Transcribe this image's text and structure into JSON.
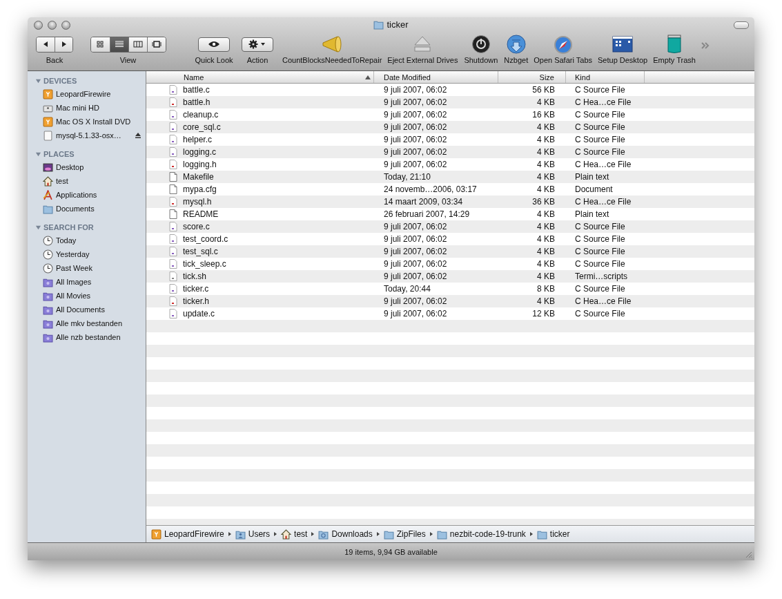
{
  "window": {
    "title": "ticker"
  },
  "toolbar": [
    {
      "kind": "nav",
      "label": "Back"
    },
    {
      "kind": "view",
      "label": "View",
      "segments": [
        {
          "selected": false
        },
        {
          "selected": true
        },
        {
          "selected": false
        },
        {
          "selected": false
        }
      ]
    },
    {
      "kind": "quicklook",
      "label": "Quick Look"
    },
    {
      "kind": "action",
      "label": "Action"
    },
    {
      "kind": "megaphone",
      "label": "CountBlocksNeededToRepair"
    },
    {
      "kind": "eject",
      "label": "Eject External Drives"
    },
    {
      "kind": "power",
      "label": "Shutdown"
    },
    {
      "kind": "download",
      "label": "Nzbget"
    },
    {
      "kind": "compass",
      "label": "Open Safari Tabs"
    },
    {
      "kind": "desktop",
      "label": "Setup Desktop"
    },
    {
      "kind": "trash",
      "label": "Empty Trash"
    }
  ],
  "sidebar": [
    {
      "title": "DEVICES",
      "expanded": true,
      "items": [
        {
          "label": "LeopardFirewire",
          "kind": "firewire",
          "ejectable": false
        },
        {
          "label": "Mac mini HD",
          "kind": "disk",
          "ejectable": false
        },
        {
          "label": "Mac OS X Install DVD",
          "kind": "firewire",
          "ejectable": false
        },
        {
          "label": "mysql-5.1.33-osx…",
          "kind": "image",
          "ejectable": true
        }
      ]
    },
    {
      "title": "PLACES",
      "expanded": true,
      "items": [
        {
          "label": "Desktop",
          "kind": "desktop"
        },
        {
          "label": "test",
          "kind": "home"
        },
        {
          "label": "Applications",
          "kind": "apps"
        },
        {
          "label": "Documents",
          "kind": "folder"
        }
      ]
    },
    {
      "title": "SEARCH FOR",
      "expanded": true,
      "items": [
        {
          "label": "Today",
          "kind": "clock"
        },
        {
          "label": "Yesterday",
          "kind": "clock"
        },
        {
          "label": "Past Week",
          "kind": "clock"
        },
        {
          "label": "All Images",
          "kind": "smart"
        },
        {
          "label": "All Movies",
          "kind": "smart"
        },
        {
          "label": "All Documents",
          "kind": "smart"
        },
        {
          "label": "Alle mkv bestanden",
          "kind": "smart"
        },
        {
          "label": "Alle nzb bestanden",
          "kind": "smart"
        }
      ]
    }
  ],
  "table": {
    "columns": [
      {
        "label": "Name",
        "sorted": true
      },
      {
        "label": "Date Modified",
        "sorted": false
      },
      {
        "label": "Size",
        "sorted": false
      },
      {
        "label": "Kind",
        "sorted": false
      }
    ],
    "rows": [
      {
        "kind": "c",
        "name": "battle.c",
        "date": "9 juli 2007, 06:02",
        "size": "56 KB",
        "type": "C Source File"
      },
      {
        "kind": "h",
        "name": "battle.h",
        "date": "9 juli 2007, 06:02",
        "size": "4 KB",
        "type": "C Hea…ce File"
      },
      {
        "kind": "c",
        "name": "cleanup.c",
        "date": "9 juli 2007, 06:02",
        "size": "16 KB",
        "type": "C Source File"
      },
      {
        "kind": "c",
        "name": "core_sql.c",
        "date": "9 juli 2007, 06:02",
        "size": "4 KB",
        "type": "C Source File"
      },
      {
        "kind": "c",
        "name": "helper.c",
        "date": "9 juli 2007, 06:02",
        "size": "4 KB",
        "type": "C Source File"
      },
      {
        "kind": "c",
        "name": "logging.c",
        "date": "9 juli 2007, 06:02",
        "size": "4 KB",
        "type": "C Source File"
      },
      {
        "kind": "h",
        "name": "logging.h",
        "date": "9 juli 2007, 06:02",
        "size": "4 KB",
        "type": "C Hea…ce File"
      },
      {
        "kind": "plain",
        "name": "Makefile",
        "date": "Today, 21:10",
        "size": "4 KB",
        "type": "Plain text"
      },
      {
        "kind": "plain",
        "name": "mypa.cfg",
        "date": "24 novemb…2006, 03:17",
        "size": "4 KB",
        "type": "Document"
      },
      {
        "kind": "h",
        "name": "mysql.h",
        "date": "14 maart 2009, 03:34",
        "size": "36 KB",
        "type": "C Hea…ce File"
      },
      {
        "kind": "plain",
        "name": "README",
        "date": "26 februari 2007, 14:29",
        "size": "4 KB",
        "type": "Plain text"
      },
      {
        "kind": "c",
        "name": "score.c",
        "date": "9 juli 2007, 06:02",
        "size": "4 KB",
        "type": "C Source File"
      },
      {
        "kind": "c",
        "name": "test_coord.c",
        "date": "9 juli 2007, 06:02",
        "size": "4 KB",
        "type": "C Source File"
      },
      {
        "kind": "c",
        "name": "test_sql.c",
        "date": "9 juli 2007, 06:02",
        "size": "4 KB",
        "type": "C Source File"
      },
      {
        "kind": "c",
        "name": "tick_sleep.c",
        "date": "9 juli 2007, 06:02",
        "size": "4 KB",
        "type": "C Source File"
      },
      {
        "kind": "script",
        "name": "tick.sh",
        "date": "9 juli 2007, 06:02",
        "size": "4 KB",
        "type": "Termi…scripts"
      },
      {
        "kind": "c",
        "name": "ticker.c",
        "date": "Today, 20:44",
        "size": "8 KB",
        "type": "C Source File"
      },
      {
        "kind": "h",
        "name": "ticker.h",
        "date": "9 juli 2007, 06:02",
        "size": "4 KB",
        "type": "C Hea…ce File"
      },
      {
        "kind": "c",
        "name": "update.c",
        "date": "9 juli 2007, 06:02",
        "size": "12 KB",
        "type": "C Source File"
      }
    ]
  },
  "path_bar": [
    {
      "label": "LeopardFirewire",
      "kind": "firewire"
    },
    {
      "label": "Users",
      "kind": "users"
    },
    {
      "label": "test",
      "kind": "home"
    },
    {
      "label": "Downloads",
      "kind": "downloads"
    },
    {
      "label": "ZipFiles",
      "kind": "folder"
    },
    {
      "label": "nezbit-code-19-trunk",
      "kind": "folder"
    },
    {
      "label": "ticker",
      "kind": "folder"
    }
  ],
  "status_bar": "19 items, 9,94 GB available"
}
